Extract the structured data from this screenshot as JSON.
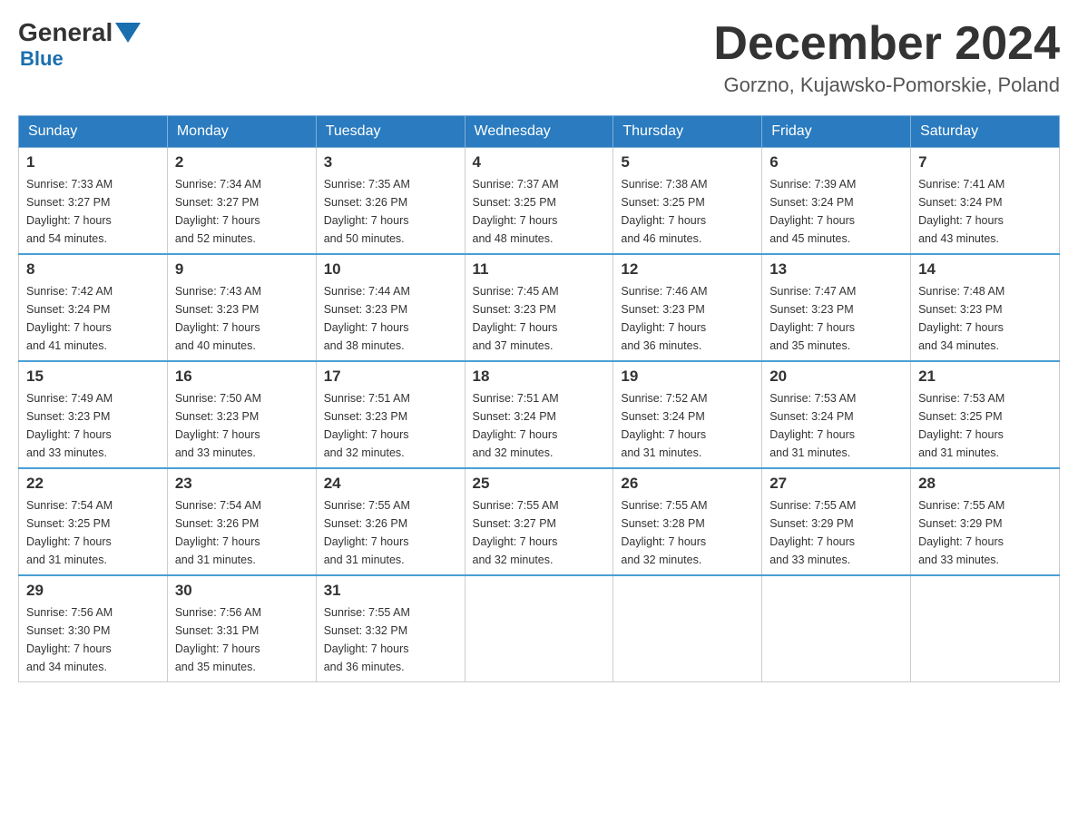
{
  "logo": {
    "text_black": "General",
    "text_blue": "Blue",
    "line2": "Blue"
  },
  "header": {
    "month_year": "December 2024",
    "location": "Gorzno, Kujawsko-Pomorskie, Poland"
  },
  "weekdays": [
    "Sunday",
    "Monday",
    "Tuesday",
    "Wednesday",
    "Thursday",
    "Friday",
    "Saturday"
  ],
  "weeks": [
    [
      {
        "day": "1",
        "sunrise": "7:33 AM",
        "sunset": "3:27 PM",
        "daylight": "7 hours and 54 minutes."
      },
      {
        "day": "2",
        "sunrise": "7:34 AM",
        "sunset": "3:27 PM",
        "daylight": "7 hours and 52 minutes."
      },
      {
        "day": "3",
        "sunrise": "7:35 AM",
        "sunset": "3:26 PM",
        "daylight": "7 hours and 50 minutes."
      },
      {
        "day": "4",
        "sunrise": "7:37 AM",
        "sunset": "3:25 PM",
        "daylight": "7 hours and 48 minutes."
      },
      {
        "day": "5",
        "sunrise": "7:38 AM",
        "sunset": "3:25 PM",
        "daylight": "7 hours and 46 minutes."
      },
      {
        "day": "6",
        "sunrise": "7:39 AM",
        "sunset": "3:24 PM",
        "daylight": "7 hours and 45 minutes."
      },
      {
        "day": "7",
        "sunrise": "7:41 AM",
        "sunset": "3:24 PM",
        "daylight": "7 hours and 43 minutes."
      }
    ],
    [
      {
        "day": "8",
        "sunrise": "7:42 AM",
        "sunset": "3:24 PM",
        "daylight": "7 hours and 41 minutes."
      },
      {
        "day": "9",
        "sunrise": "7:43 AM",
        "sunset": "3:23 PM",
        "daylight": "7 hours and 40 minutes."
      },
      {
        "day": "10",
        "sunrise": "7:44 AM",
        "sunset": "3:23 PM",
        "daylight": "7 hours and 38 minutes."
      },
      {
        "day": "11",
        "sunrise": "7:45 AM",
        "sunset": "3:23 PM",
        "daylight": "7 hours and 37 minutes."
      },
      {
        "day": "12",
        "sunrise": "7:46 AM",
        "sunset": "3:23 PM",
        "daylight": "7 hours and 36 minutes."
      },
      {
        "day": "13",
        "sunrise": "7:47 AM",
        "sunset": "3:23 PM",
        "daylight": "7 hours and 35 minutes."
      },
      {
        "day": "14",
        "sunrise": "7:48 AM",
        "sunset": "3:23 PM",
        "daylight": "7 hours and 34 minutes."
      }
    ],
    [
      {
        "day": "15",
        "sunrise": "7:49 AM",
        "sunset": "3:23 PM",
        "daylight": "7 hours and 33 minutes."
      },
      {
        "day": "16",
        "sunrise": "7:50 AM",
        "sunset": "3:23 PM",
        "daylight": "7 hours and 33 minutes."
      },
      {
        "day": "17",
        "sunrise": "7:51 AM",
        "sunset": "3:23 PM",
        "daylight": "7 hours and 32 minutes."
      },
      {
        "day": "18",
        "sunrise": "7:51 AM",
        "sunset": "3:24 PM",
        "daylight": "7 hours and 32 minutes."
      },
      {
        "day": "19",
        "sunrise": "7:52 AM",
        "sunset": "3:24 PM",
        "daylight": "7 hours and 31 minutes."
      },
      {
        "day": "20",
        "sunrise": "7:53 AM",
        "sunset": "3:24 PM",
        "daylight": "7 hours and 31 minutes."
      },
      {
        "day": "21",
        "sunrise": "7:53 AM",
        "sunset": "3:25 PM",
        "daylight": "7 hours and 31 minutes."
      }
    ],
    [
      {
        "day": "22",
        "sunrise": "7:54 AM",
        "sunset": "3:25 PM",
        "daylight": "7 hours and 31 minutes."
      },
      {
        "day": "23",
        "sunrise": "7:54 AM",
        "sunset": "3:26 PM",
        "daylight": "7 hours and 31 minutes."
      },
      {
        "day": "24",
        "sunrise": "7:55 AM",
        "sunset": "3:26 PM",
        "daylight": "7 hours and 31 minutes."
      },
      {
        "day": "25",
        "sunrise": "7:55 AM",
        "sunset": "3:27 PM",
        "daylight": "7 hours and 32 minutes."
      },
      {
        "day": "26",
        "sunrise": "7:55 AM",
        "sunset": "3:28 PM",
        "daylight": "7 hours and 32 minutes."
      },
      {
        "day": "27",
        "sunrise": "7:55 AM",
        "sunset": "3:29 PM",
        "daylight": "7 hours and 33 minutes."
      },
      {
        "day": "28",
        "sunrise": "7:55 AM",
        "sunset": "3:29 PM",
        "daylight": "7 hours and 33 minutes."
      }
    ],
    [
      {
        "day": "29",
        "sunrise": "7:56 AM",
        "sunset": "3:30 PM",
        "daylight": "7 hours and 34 minutes."
      },
      {
        "day": "30",
        "sunrise": "7:56 AM",
        "sunset": "3:31 PM",
        "daylight": "7 hours and 35 minutes."
      },
      {
        "day": "31",
        "sunrise": "7:55 AM",
        "sunset": "3:32 PM",
        "daylight": "7 hours and 36 minutes."
      },
      null,
      null,
      null,
      null
    ]
  ],
  "labels": {
    "sunrise_prefix": "Sunrise: ",
    "sunset_prefix": "Sunset: ",
    "daylight_prefix": "Daylight: "
  }
}
